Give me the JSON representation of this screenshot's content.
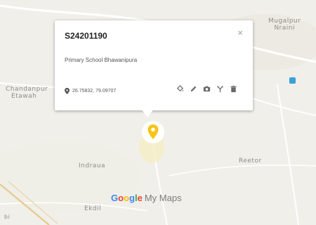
{
  "map": {
    "places": {
      "mugalpur": "Mugalpur\nNraini",
      "chandanpur": "Chandanpur",
      "etawah": "Etawah",
      "indraua": "Indraua",
      "reetor": "Reetor",
      "ekdil": "Ekdil",
      "edge": "bi"
    },
    "colors": {
      "background": "#f0efe9",
      "road": "#ffffff",
      "rail": "#e6c98c",
      "marker": "#f5c518"
    },
    "brand": {
      "google": "Google",
      "my_maps": "My Maps"
    }
  },
  "popup": {
    "title": "S24201190",
    "close_label": "×",
    "description": "Primary School Bhawanipura",
    "coordinates": "26.75832, 79.09707",
    "tools": [
      "paint-bucket-icon",
      "edit-icon",
      "camera-icon",
      "directions-icon",
      "delete-icon"
    ]
  }
}
